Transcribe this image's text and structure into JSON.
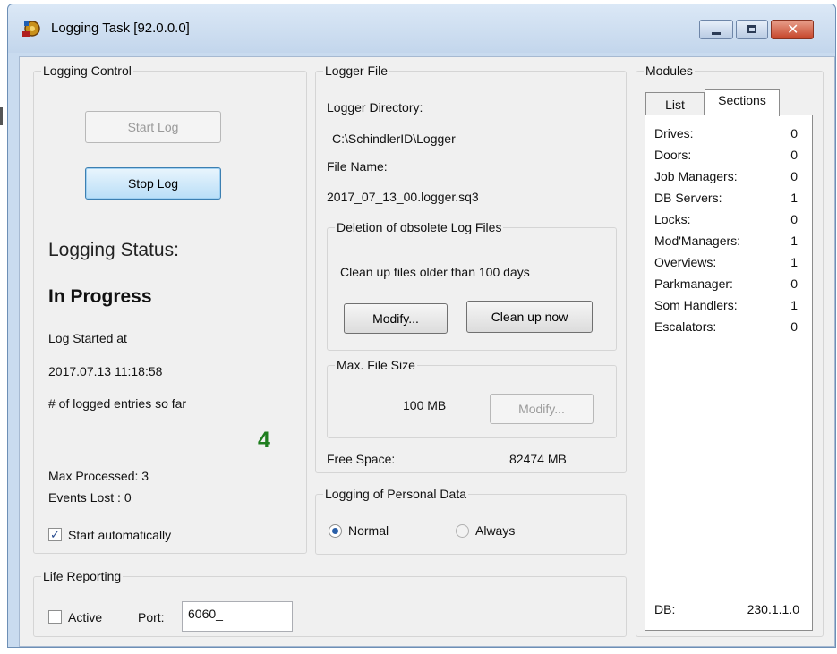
{
  "window": {
    "title": "Logging Task [92.0.0.0]",
    "controls": {
      "minimize": "minimize-icon",
      "maximize": "maximize-icon",
      "close": "close-icon"
    }
  },
  "logging_control": {
    "legend": "Logging Control",
    "start_button": "Start Log",
    "stop_button": "Stop Log",
    "status_label": "Logging Status:",
    "status_value": "In Progress",
    "started_label": "Log Started at",
    "started_value": "2017.07.13 11:18:58",
    "entries_label": "# of logged entries so far",
    "entries_value": "4",
    "max_processed": "Max Processed: 3",
    "events_lost": "Events Lost  : 0",
    "auto_start_label": "Start automatically",
    "auto_start_checked": true
  },
  "logger_file": {
    "legend": "Logger File",
    "directory_label": "Logger Directory:",
    "directory_value": "C:\\SchindlerID\\Logger",
    "filename_label": "File Name:",
    "filename_value": "2017_07_13_00.logger.sq3",
    "deletion": {
      "legend": "Deletion of obsolete Log Files",
      "text": "Clean up files older than 100 days",
      "modify_button": "Modify...",
      "cleanup_button": "Clean up now"
    },
    "max_size": {
      "legend": "Max. File Size",
      "value": "100 MB",
      "modify_button": "Modify..."
    },
    "free_space_label": "Free Space:",
    "free_space_value": "82474 MB"
  },
  "personal_data": {
    "legend": "Logging of Personal Data",
    "options": [
      "Normal",
      "Always"
    ],
    "selected": "Normal"
  },
  "life_reporting": {
    "legend": "Life Reporting",
    "active_label": "Active",
    "active_checked": false,
    "port_label": "Port:",
    "port_value": "6060_"
  },
  "modules": {
    "legend": "Modules",
    "tabs": [
      "List",
      "Sections"
    ],
    "active_tab": "Sections",
    "items": [
      {
        "name": "Drives:",
        "count": "0"
      },
      {
        "name": "Doors:",
        "count": "0"
      },
      {
        "name": "Job Managers:",
        "count": "0"
      },
      {
        "name": "DB Servers:",
        "count": "1"
      },
      {
        "name": "Locks:",
        "count": "0"
      },
      {
        "name": "Mod'Managers:",
        "count": "1"
      },
      {
        "name": "Overviews:",
        "count": "1"
      },
      {
        "name": "Parkmanager:",
        "count": "0"
      },
      {
        "name": "Som Handlers:",
        "count": "1"
      },
      {
        "name": "Escalators:",
        "count": "0"
      }
    ],
    "db_label": "DB:",
    "db_value": "230.1.1.0"
  },
  "colors": {
    "entries_count": "#1e7d1e",
    "title_bar": "#c9dbef",
    "close_button": "#c6452a"
  }
}
